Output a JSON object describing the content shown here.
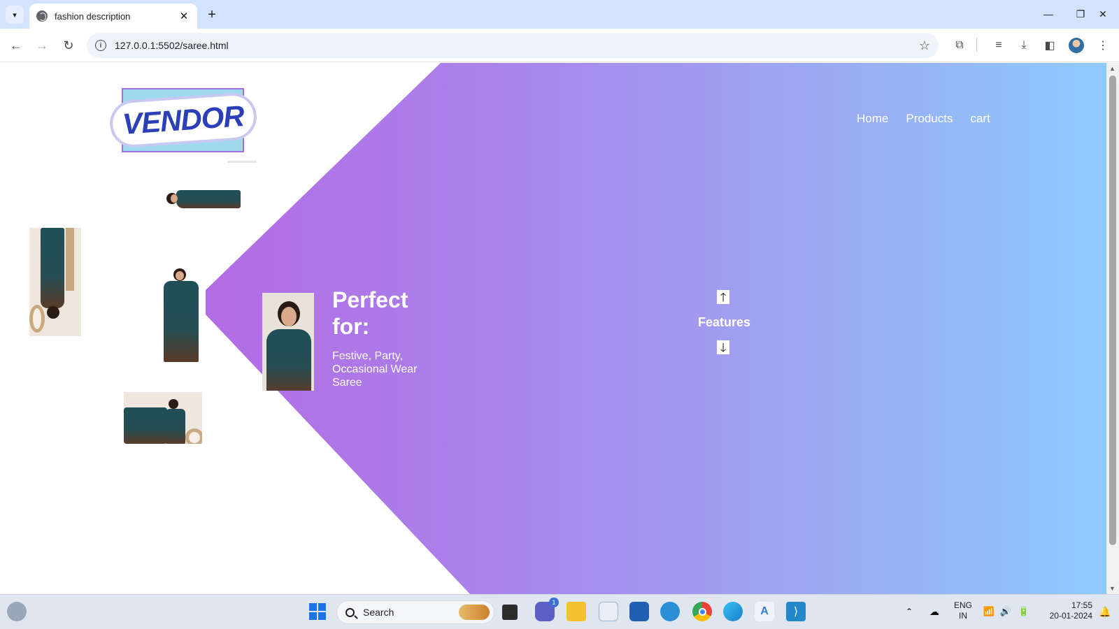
{
  "browser": {
    "tab_title": "fashion description",
    "url": "127.0.0.1:5502/saree.html",
    "new_tab_label": "+",
    "close_tab_label": "✕"
  },
  "page": {
    "logo_text": "VENDOR",
    "nav": [
      "Home",
      "Products",
      "cart"
    ],
    "hero": {
      "title": "Perfect for:",
      "subtitle": "Festive, Party, Occasional Wear Saree"
    },
    "features": {
      "label": "Features",
      "up_icon": "arrow-up-icon",
      "down_icon": "arrow-down-icon"
    },
    "thumbnails": [
      "saree-photo-rotated",
      "saree-photo-upside-down",
      "saree-photo-standing",
      "saree-photo-wide"
    ]
  },
  "taskbar": {
    "search_label": "Search",
    "language": "ENG",
    "region": "IN",
    "time": "17:55",
    "date": "20-01-2024",
    "teams_badge": "1"
  },
  "colors": {
    "hero_gradient_start": "#b95ce0",
    "hero_gradient_end": "#8ecbfd",
    "tabstrip": "#d3e3fd"
  }
}
